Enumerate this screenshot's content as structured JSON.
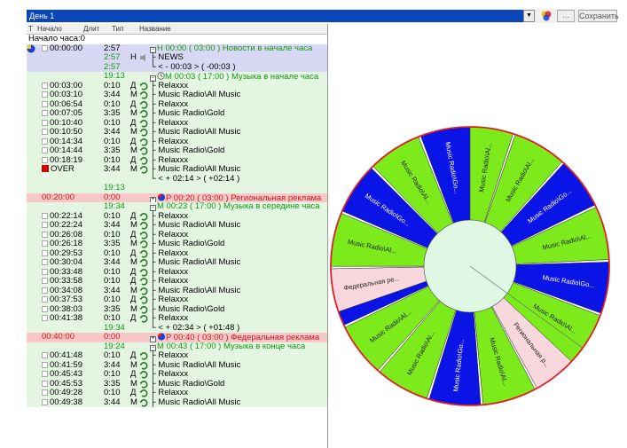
{
  "toolbar": {
    "day": "День 1",
    "browse_label": "...",
    "save_label": "Сохранить"
  },
  "columns": [
    "Т",
    "Начало",
    "Длит",
    "Тип",
    "Название"
  ],
  "hour_start": "Начало часа:0",
  "rows": [
    {
      "kind": "block",
      "bg": "blue",
      "icon": "yb",
      "start": "00:00:00",
      "dur": "2:57",
      "typ": "H",
      "title": "H 00:00 ( 03:00 ) Новости в начале часа",
      "cls": "green",
      "toggle": "−"
    },
    {
      "kind": "item",
      "bg": "blue",
      "dur": "2:57",
      "typ": "Н",
      "title": "NEWS",
      "status": "speaker"
    },
    {
      "kind": "sum",
      "bg": "blue",
      "dur": "2:57",
      "title": "< - 00:03 > ( -00:03 )"
    },
    {
      "kind": "block",
      "bg": "green",
      "icon": "",
      "dur": "19:13",
      "typ": "",
      "title": "M 00:03 ( 17:00 ) Музыка в начале часа",
      "cls": "green",
      "toggle": "−",
      "clock": true
    },
    {
      "kind": "item",
      "bg": "green",
      "start": "00:03:00",
      "dur": "0:10",
      "typ": "Д",
      "title": "Relaxxx"
    },
    {
      "kind": "item",
      "bg": "green",
      "start": "00:03:10",
      "dur": "3:44",
      "typ": "М",
      "title": "Music Radio\\All Music"
    },
    {
      "kind": "item",
      "bg": "green",
      "start": "00:06:54",
      "dur": "0:10",
      "typ": "Д",
      "title": "Relaxxx"
    },
    {
      "kind": "item",
      "bg": "green",
      "start": "00:07:05",
      "dur": "3:35",
      "typ": "М",
      "title": "Music Radio\\Gold"
    },
    {
      "kind": "item",
      "bg": "green",
      "start": "00:10:40",
      "dur": "0:10",
      "typ": "Д",
      "title": "Relaxxx"
    },
    {
      "kind": "item",
      "bg": "green",
      "start": "00:10:50",
      "dur": "3:44",
      "typ": "М",
      "title": "Music Radio\\All Music"
    },
    {
      "kind": "item",
      "bg": "green",
      "start": "00:14:34",
      "dur": "0:10",
      "typ": "Д",
      "title": "Relaxxx"
    },
    {
      "kind": "item",
      "bg": "green",
      "start": "00:14:44",
      "dur": "3:35",
      "typ": "М",
      "title": "Music Radio\\Gold"
    },
    {
      "kind": "item",
      "bg": "green",
      "start": "00:18:19",
      "dur": "0:10",
      "typ": "Д",
      "title": "Relaxxx"
    },
    {
      "kind": "item",
      "bg": "green",
      "start": "OVER",
      "dur": "3:44",
      "typ": "М",
      "title": "Music Radio\\All Music",
      "over": true
    },
    {
      "kind": "sum",
      "bg": "green",
      "dur": "",
      "title": "< + 02:14 > ( +02:14 )"
    },
    {
      "kind": "sum",
      "bg": "green",
      "dur": "19:13",
      "title": ""
    },
    {
      "kind": "block",
      "bg": "pink",
      "icon": "rb",
      "start": "00:20:00",
      "dur": "0:00",
      "typ": "",
      "title": "P 00:20 ( 03:00 ) Региональная реклама",
      "cls": "red",
      "toggle": "+"
    },
    {
      "kind": "block",
      "bg": "green",
      "icon": "",
      "dur": "19:34",
      "typ": "",
      "title": "M 00:23 ( 17:00 ) Музыка в середине часа",
      "cls": "green",
      "toggle": "−"
    },
    {
      "kind": "item",
      "bg": "green",
      "start": "00:22:14",
      "dur": "0:10",
      "typ": "Д",
      "title": "Relaxxx"
    },
    {
      "kind": "item",
      "bg": "green",
      "start": "00:22:24",
      "dur": "3:44",
      "typ": "М",
      "title": "Music Radio\\All Music"
    },
    {
      "kind": "item",
      "bg": "green",
      "start": "00:26:08",
      "dur": "0:10",
      "typ": "Д",
      "title": "Relaxxx"
    },
    {
      "kind": "item",
      "bg": "green",
      "start": "00:26:18",
      "dur": "3:35",
      "typ": "М",
      "title": "Music Radio\\Gold"
    },
    {
      "kind": "item",
      "bg": "green",
      "start": "00:29:53",
      "dur": "0:10",
      "typ": "Д",
      "title": "Relaxxx"
    },
    {
      "kind": "item",
      "bg": "green",
      "start": "00:30:04",
      "dur": "3:44",
      "typ": "М",
      "title": "Music Radio\\All Music"
    },
    {
      "kind": "item",
      "bg": "green",
      "start": "00:33:48",
      "dur": "0:10",
      "typ": "Д",
      "title": "Relaxxx"
    },
    {
      "kind": "item",
      "bg": "green",
      "start": "00:33:58",
      "dur": "0:10",
      "typ": "Д",
      "title": "Relaxxx"
    },
    {
      "kind": "item",
      "bg": "green",
      "start": "00:34:08",
      "dur": "3:44",
      "typ": "М",
      "title": "Music Radio\\All Music"
    },
    {
      "kind": "item",
      "bg": "green",
      "start": "00:37:53",
      "dur": "0:10",
      "typ": "Д",
      "title": "Relaxxx"
    },
    {
      "kind": "item",
      "bg": "green",
      "start": "00:38:03",
      "dur": "3:35",
      "typ": "М",
      "title": "Music Radio\\Gold"
    },
    {
      "kind": "item",
      "bg": "green",
      "start": "00:41:38",
      "dur": "0:10",
      "typ": "Д",
      "title": "Relaxxx"
    },
    {
      "kind": "sum",
      "bg": "green",
      "dur": "19:34",
      "title": "< + 02:34 > ( +01:48 )"
    },
    {
      "kind": "block",
      "bg": "pink",
      "icon": "rb",
      "start": "00:40:00",
      "dur": "0:00",
      "typ": "",
      "title": "P 00:40 ( 03:00 ) Федеральная реклама",
      "cls": "red",
      "toggle": "+"
    },
    {
      "kind": "block",
      "bg": "green",
      "icon": "",
      "dur": "19:24",
      "typ": "",
      "title": "M 00:43 ( 17:00 ) Музыка в конце часа",
      "cls": "green",
      "toggle": "−"
    },
    {
      "kind": "item",
      "bg": "green",
      "start": "00:41:48",
      "dur": "0:10",
      "typ": "Д",
      "title": "Relaxxx"
    },
    {
      "kind": "item",
      "bg": "green",
      "start": "00:41:59",
      "dur": "3:44",
      "typ": "М",
      "title": "Music Radio\\All Music"
    },
    {
      "kind": "item",
      "bg": "green",
      "start": "00:45:43",
      "dur": "0:10",
      "typ": "Д",
      "title": "Relaxxx"
    },
    {
      "kind": "item",
      "bg": "green",
      "start": "00:45:53",
      "dur": "3:35",
      "typ": "М",
      "title": "Music Radio\\Gold"
    },
    {
      "kind": "item",
      "bg": "green",
      "start": "00:49:28",
      "dur": "0:10",
      "typ": "Д",
      "title": "Relaxxx"
    },
    {
      "kind": "item",
      "bg": "green",
      "start": "00:49:38",
      "dur": "3:44",
      "typ": "М",
      "title": "Music Radio\\All Music"
    }
  ],
  "wheel": {
    "colors": {
      "green": "#7dea1c",
      "blue": "#0b14e6",
      "pink": "#f9d8dd",
      "white": "#ffffff",
      "ring": "#e02020",
      "inner": "#dff8e4"
    },
    "segments": [
      {
        "min": 3.0,
        "dur": 0.17,
        "color": "white"
      },
      {
        "min": 3.17,
        "dur": 3.73,
        "color": "green",
        "label": "Music Radio\\Al..."
      },
      {
        "min": 6.9,
        "dur": 0.17,
        "color": "white"
      },
      {
        "min": 7.07,
        "dur": 3.58,
        "color": "blue",
        "label": "Music Radio\\Go..."
      },
      {
        "min": 10.65,
        "dur": 0.17,
        "color": "white"
      },
      {
        "min": 10.82,
        "dur": 3.73,
        "color": "green",
        "label": "Music Radio\\Al..."
      },
      {
        "min": 14.55,
        "dur": 0.17,
        "color": "white"
      },
      {
        "min": 14.72,
        "dur": 3.58,
        "color": "blue",
        "label": "Music Radio\\Go..."
      },
      {
        "min": 18.3,
        "dur": 0.17,
        "color": "white"
      },
      {
        "min": 18.47,
        "dur": 3.73,
        "color": "green",
        "label": "Music Radio\\Al..."
      },
      {
        "min": 22.2,
        "dur": 3.0,
        "color": "pink",
        "label": "Региональная р..."
      },
      {
        "min": 25.2,
        "dur": 0.17,
        "color": "white"
      },
      {
        "min": 25.37,
        "dur": 3.73,
        "color": "green",
        "label": "Music Radio\\Al..."
      },
      {
        "min": 29.1,
        "dur": 0.17,
        "color": "white"
      },
      {
        "min": 29.27,
        "dur": 3.58,
        "color": "blue",
        "label": "Music Radio\\Go..."
      },
      {
        "min": 32.85,
        "dur": 0.17,
        "color": "white"
      },
      {
        "min": 33.02,
        "dur": 3.73,
        "color": "green",
        "label": "Music Radio\\Al..."
      },
      {
        "min": 36.75,
        "dur": 0.17,
        "color": "white"
      },
      {
        "min": 36.92,
        "dur": 3.73,
        "color": "green",
        "label": "Music Radio\\Al..."
      },
      {
        "min": 40.65,
        "dur": 0.17,
        "color": "white"
      },
      {
        "min": 40.82,
        "dur": 1.0,
        "color": "blue"
      },
      {
        "min": 41.82,
        "dur": 3.0,
        "color": "pink",
        "label": "Федеральная ре..."
      },
      {
        "min": 44.82,
        "dur": 0.17,
        "color": "white"
      },
      {
        "min": 44.99,
        "dur": 3.73,
        "color": "green",
        "label": "Music Radio\\Al..."
      },
      {
        "min": 48.72,
        "dur": 0.17,
        "color": "white"
      },
      {
        "min": 48.89,
        "dur": 3.58,
        "color": "blue",
        "label": "Music Radio\\Go..."
      },
      {
        "min": 52.47,
        "dur": 0.17,
        "color": "white"
      },
      {
        "min": 52.64,
        "dur": 3.73,
        "color": "green",
        "label": "Music Radio\\Al..."
      },
      {
        "min": 56.37,
        "dur": 0.17,
        "color": "white"
      },
      {
        "min": 56.54,
        "dur": 3.46,
        "color": "blue",
        "label": "Music Radio\\Go..."
      },
      {
        "min": 0.0,
        "dur": 3.0,
        "color": "green",
        "label": "Music Radio\\Al..."
      }
    ]
  }
}
